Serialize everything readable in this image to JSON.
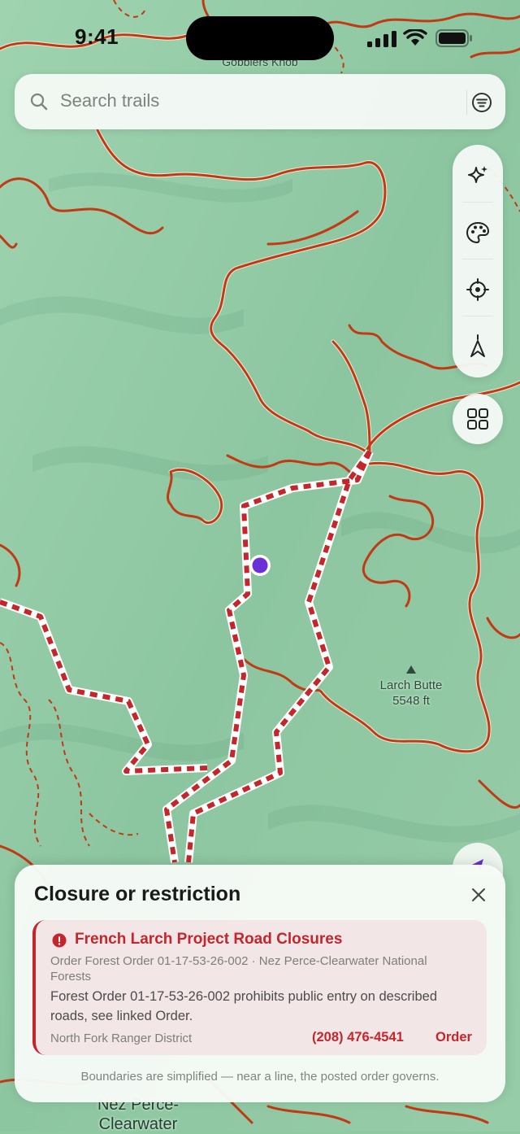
{
  "status_bar": {
    "time": "9:41"
  },
  "search": {
    "placeholder": "Search trails"
  },
  "map": {
    "labels": {
      "top_peak": "Gobblers Knob",
      "peak_name": "Larch Butte",
      "peak_elevation": "5548 ft",
      "forest_name_line1": "Nez Perce-",
      "forest_name_line2": "Clearwater"
    },
    "colors": {
      "terrain": "#8fc9a2",
      "trail": "#c23a14",
      "closure_dash": "#c4262c",
      "location_dot": "#6a2fd6"
    }
  },
  "toolbar": {
    "icons": [
      "sparkle-icon",
      "palette-icon",
      "locate-icon",
      "compass-icon"
    ],
    "layers_icon": "grid-icon"
  },
  "sheet": {
    "title": "Closure or restriction",
    "card": {
      "title": "French Larch Project Road Closures",
      "meta": "Order Forest Order 01-17-53-26-002 · Nez Perce-Clearwater National Forests",
      "body": "Forest Order 01-17-53-26-002 prohibits public entry on described roads, see linked Order.",
      "district": "North Fork Ranger District",
      "phone": "(208) 476-4541",
      "order_link": "Order"
    },
    "disclaimer": "Boundaries are simplified — near a line, the posted order governs."
  }
}
